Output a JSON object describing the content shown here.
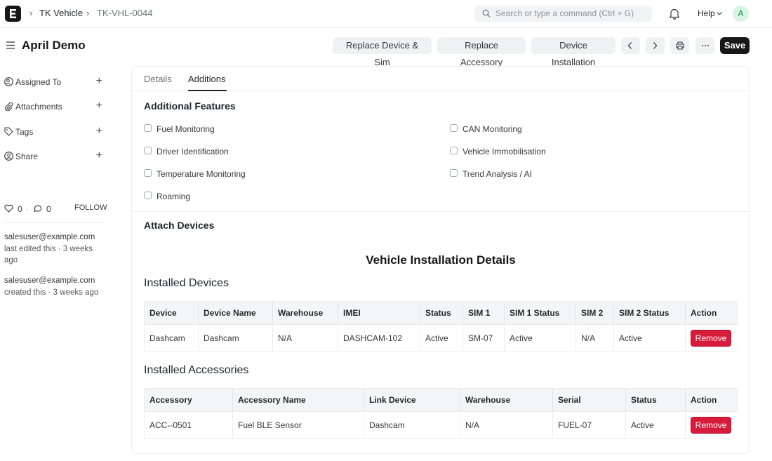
{
  "navbar": {
    "breadcrumbs": [
      "TK Vehicle",
      "TK-VHL-0044"
    ],
    "search_placeholder": "Search or type a command (Ctrl + G)",
    "help_label": "Help",
    "avatar_initial": "A"
  },
  "page": {
    "title": "April Demo",
    "actions": {
      "replace_device_sim": "Replace Device & Sim",
      "replace_accessory": "Replace Accessory",
      "device_installation": "Device Installation",
      "save": "Save"
    }
  },
  "sidebar": {
    "items": [
      {
        "label": "Assigned To",
        "icon": "user-check-icon"
      },
      {
        "label": "Attachments",
        "icon": "paperclip-icon"
      },
      {
        "label": "Tags",
        "icon": "tag-icon"
      },
      {
        "label": "Share",
        "icon": "share-user-icon"
      }
    ],
    "likes_count": "0",
    "comments_count": "0",
    "follow_label": "FOLLOW",
    "activity": [
      {
        "email": "salesuser@example.com",
        "text": "last edited this · 3 weeks ago"
      },
      {
        "email": "salesuser@example.com",
        "text": "created this · 3 weeks ago"
      }
    ]
  },
  "tabs": [
    {
      "label": "Details",
      "active": false
    },
    {
      "label": "Additions",
      "active": true
    }
  ],
  "additional_features": {
    "title": "Additional Features",
    "left": [
      "Fuel Monitoring",
      "Driver Identification",
      "Temperature Monitoring",
      "Roaming"
    ],
    "right": [
      "CAN Monitoring",
      "Vehicle Immobilisation",
      "Trend Analysis / AI"
    ]
  },
  "attach_devices": {
    "title": "Attach Devices",
    "html_title": "Vehicle Installation Details"
  },
  "installed_devices": {
    "title": "Installed Devices",
    "columns": [
      "Device",
      "Device Name",
      "Warehouse",
      "IMEI",
      "Status",
      "SIM 1",
      "SIM 1 Status",
      "SIM 2",
      "SIM 2 Status",
      "Action"
    ],
    "rows": [
      {
        "cells": [
          "Dashcam",
          "Dashcam",
          "N/A",
          "DASHCAM-102",
          "Active",
          "SM-07",
          "Active",
          "N/A",
          "Active"
        ],
        "action": "Remove"
      }
    ]
  },
  "installed_accessories": {
    "title": "Installed Accessories",
    "columns": [
      "Accessory",
      "Accessory Name",
      "Link Device",
      "Warehouse",
      "Serial",
      "Status",
      "Action"
    ],
    "rows": [
      {
        "cells": [
          "ACC--0501",
          "Fuel BLE Sensor",
          "Dashcam",
          "N/A",
          "FUEL-07",
          "Active"
        ],
        "action": "Remove"
      }
    ]
  },
  "colors": {
    "primary_button": "#171717",
    "danger_button": "#d71b3b",
    "avatar_bg": "#d8f5e3"
  }
}
